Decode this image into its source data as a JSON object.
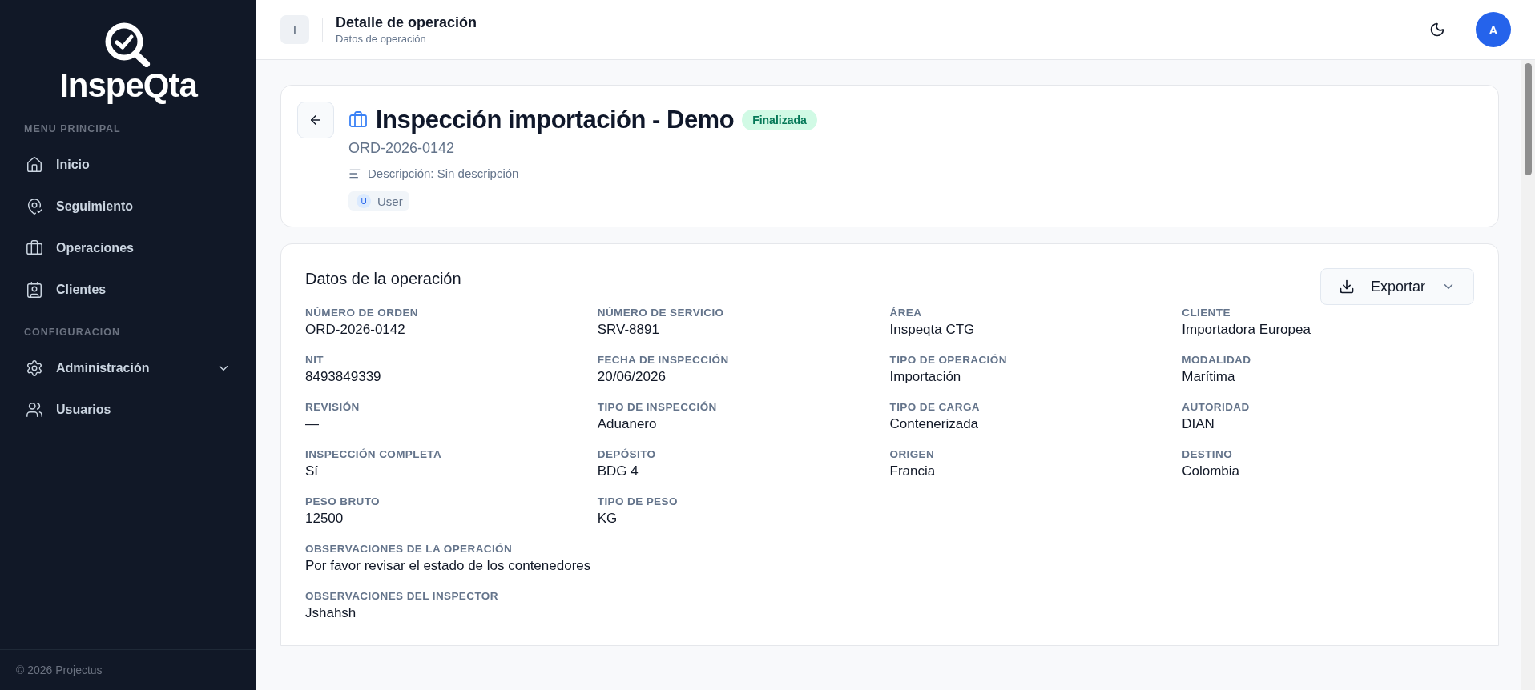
{
  "sidebar": {
    "logo": "InspeQta",
    "sections": [
      {
        "title": "MENU PRINCIPAL",
        "items": [
          {
            "label": "Inicio",
            "expandable": false
          },
          {
            "label": "Seguimiento",
            "expandable": false
          },
          {
            "label": "Operaciones",
            "expandable": false
          },
          {
            "label": "Clientes",
            "expandable": false
          }
        ]
      },
      {
        "title": "CONFIGURACION",
        "items": [
          {
            "label": "Administración",
            "expandable": true
          },
          {
            "label": "Usuarios",
            "expandable": false
          }
        ]
      }
    ],
    "footer": "© 2026 Projectus"
  },
  "header": {
    "toggle": "I",
    "title": "Detalle de operación",
    "subtitle": "Datos de operación",
    "avatar": "A"
  },
  "summary": {
    "title": "Inspección importación - Demo",
    "status": "Finalizada",
    "code": "ORD-2026-0142",
    "description": "Descripción: Sin descripción",
    "user_initial": "U",
    "user": "User"
  },
  "details": {
    "title": "Datos de la operación",
    "export": "Exportar",
    "fields": [
      {
        "label": "NÚMERO DE ORDEN",
        "value": "ORD-2026-0142",
        "kind": "field"
      },
      {
        "label": "NÚMERO DE SERVICIO",
        "value": "SRV-8891",
        "kind": "field"
      },
      {
        "label": "ÁREA",
        "value": "Inspeqta CTG",
        "kind": "field"
      },
      {
        "label": "CLIENTE",
        "value": "Importadora Europea",
        "kind": "field"
      },
      {
        "label": "NIT",
        "value": "8493849339",
        "kind": "field"
      },
      {
        "label": "FECHA DE INSPECCIÓN",
        "value": "20/06/2026",
        "kind": "field"
      },
      {
        "label": "TIPO DE OPERACIÓN",
        "value": "Importación",
        "kind": "field"
      },
      {
        "label": "MODALIDAD",
        "value": "Marítima",
        "kind": "field"
      },
      {
        "label": "REVISIÓN",
        "value": "—",
        "kind": "field"
      },
      {
        "label": "TIPO DE INSPECCIÓN",
        "value": "Aduanero",
        "kind": "field"
      },
      {
        "label": "TIPO DE CARGA",
        "value": "Contenerizada",
        "kind": "field"
      },
      {
        "label": "AUTORIDAD",
        "value": "DIAN",
        "kind": "field"
      },
      {
        "label": "INSPECCIÓN COMPLETA",
        "value": "Sí",
        "kind": "field"
      },
      {
        "label": "DEPÓSITO",
        "value": "BDG 4",
        "kind": "field"
      },
      {
        "label": "ORIGEN",
        "value": "Francia",
        "kind": "field"
      },
      {
        "label": "DESTINO",
        "value": "Colombia",
        "kind": "field"
      },
      {
        "label": "PESO BRUTO",
        "value": "12500",
        "kind": "field"
      },
      {
        "label": "TIPO DE PESO",
        "value": "KG",
        "kind": "field"
      },
      {
        "label": "OBSERVACIONES DE LA OPERACIÓN",
        "value": "Por favor revisar el estado de los contenedores",
        "kind": "wide"
      },
      {
        "label": "OBSERVACIONES DEL INSPECTOR",
        "value": "Jshahsh",
        "kind": "wide"
      }
    ]
  }
}
